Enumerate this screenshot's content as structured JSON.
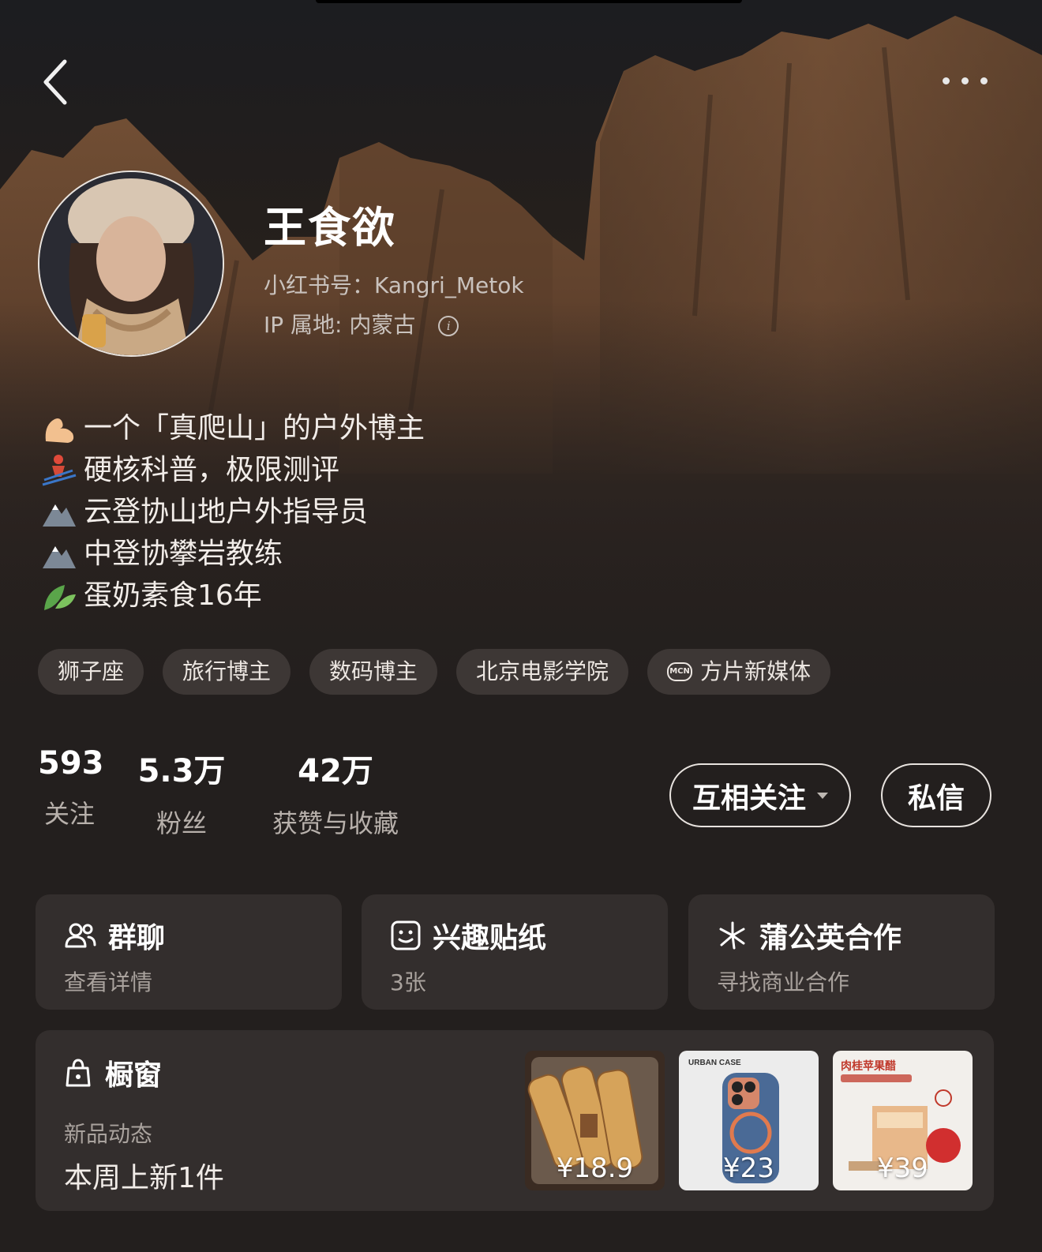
{
  "profile": {
    "name": "王食欲",
    "id_line": "小红书号：Kangri_Metok",
    "ip_line": "IP 属地: 内蒙古",
    "info_glyph": "i"
  },
  "bio": [
    {
      "icon": "flexed-biceps-icon",
      "text": "一个「真爬山」的户外博主"
    },
    {
      "icon": "skier-icon",
      "text": "硬核科普，极限测评"
    },
    {
      "icon": "mountain-icon",
      "text": "云登协山地户外指导员"
    },
    {
      "icon": "mountain-icon",
      "text": "中登协攀岩教练"
    },
    {
      "icon": "leaves-icon",
      "text": "蛋奶素食16年"
    }
  ],
  "tags": [
    "狮子座",
    "旅行博主",
    "数码博主",
    "北京电影学院",
    "方片新媒体"
  ],
  "mcn_badge": "MCN",
  "stats": [
    {
      "value": "593",
      "label": "关注"
    },
    {
      "value": "5.3万",
      "label": "粉丝"
    },
    {
      "value": "42万",
      "label": "获赞与收藏"
    }
  ],
  "actions": {
    "follow_label": "互相关注",
    "message_label": "私信"
  },
  "cards": [
    {
      "icon": "group-chat-icon",
      "title": "群聊",
      "subtitle": "查看详情"
    },
    {
      "icon": "sticker-icon",
      "title": "兴趣贴纸",
      "subtitle": "3张"
    },
    {
      "icon": "dandelion-icon",
      "title": "蒲公英合作",
      "subtitle": "寻找商业合作"
    }
  ],
  "shop": {
    "title": "橱窗",
    "subtitle": "新品动态",
    "new_items": "本周上新1件",
    "products": [
      {
        "price": "¥18.9"
      },
      {
        "price": "¥23",
        "brand_text": "URBAN CASE"
      },
      {
        "price": "¥39",
        "label_text": "肉桂苹果醋"
      }
    ]
  },
  "colors": {
    "background": "#231f1e",
    "card": "#332e2d",
    "tag": "#3d3735"
  }
}
